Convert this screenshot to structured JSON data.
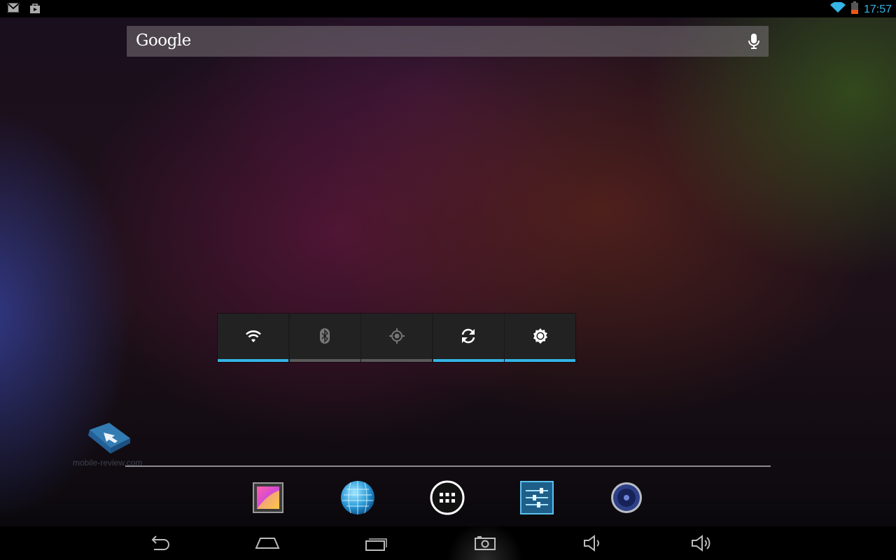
{
  "status_bar": {
    "time": "17:57",
    "left_icons": [
      "gmail-icon",
      "play-store-bag-icon"
    ],
    "right_icons": [
      "wifi-signal-icon",
      "battery-low-icon"
    ],
    "accent": "#33b5e5"
  },
  "search": {
    "logo_text": "Google",
    "mic_icon": "microphone-icon"
  },
  "power_control": {
    "toggles": [
      {
        "icon": "wifi-icon",
        "on": true
      },
      {
        "icon": "bluetooth-icon",
        "on": false
      },
      {
        "icon": "gps-icon",
        "on": false
      },
      {
        "icon": "sync-icon",
        "on": true
      },
      {
        "icon": "brightness-icon",
        "on": true
      }
    ],
    "on_color": "#33b5e5",
    "off_color": "#5a5a5a"
  },
  "watermark": {
    "text": "mobile-review.com"
  },
  "dock": {
    "items": [
      "gallery-app-icon",
      "browser-globe-icon",
      "all-apps-icon",
      "settings-app-icon",
      "music-app-icon"
    ]
  },
  "nav_bar": {
    "buttons": [
      "back-icon",
      "home-icon",
      "recent-apps-icon",
      "screenshot-icon",
      "volume-down-icon",
      "volume-up-icon"
    ]
  }
}
